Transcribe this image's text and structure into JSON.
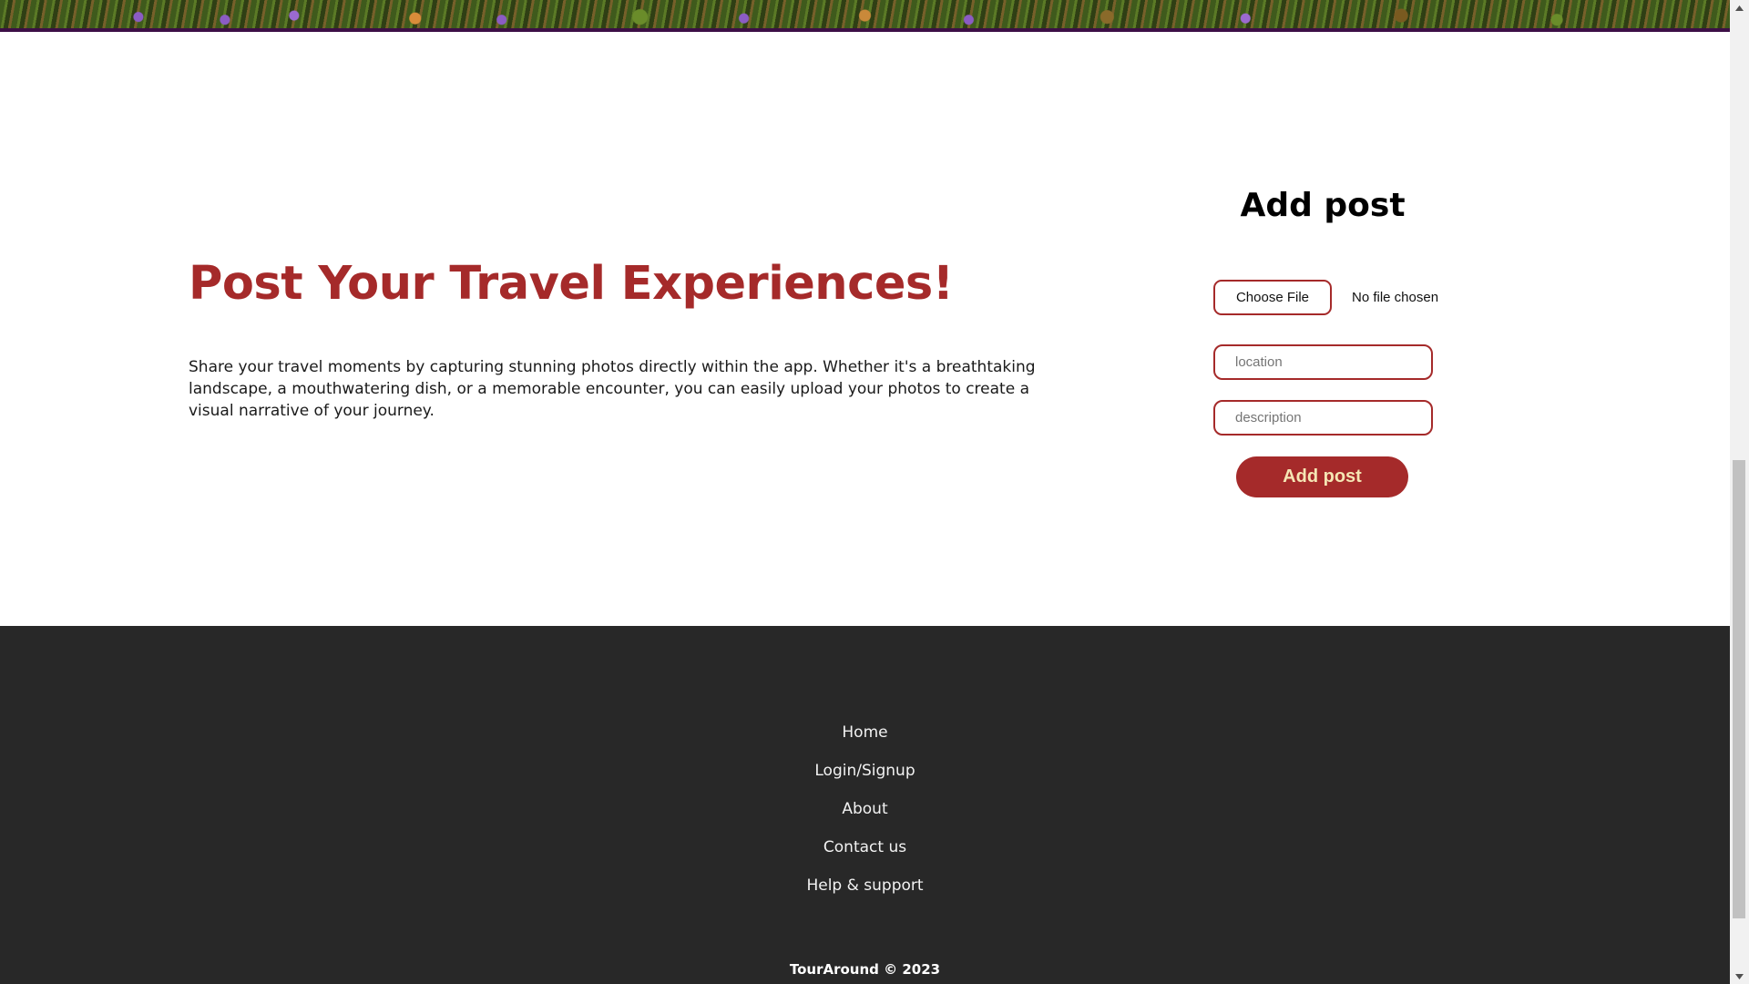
{
  "main": {
    "title": "Post Your Travel Experiences!",
    "description": "Share your travel moments by capturing stunning photos directly within the app. Whether it's a breathtaking landscape, a mouthwatering dish, or a memorable encounter, you can easily upload your photos to create a visual narrative of your journey."
  },
  "form": {
    "title": "Add post",
    "file_button": "Choose File",
    "file_status": "No file chosen",
    "location_placeholder": "location",
    "description_placeholder": "description",
    "submit_label": "Add post"
  },
  "footer": {
    "links": [
      "Home",
      "Login/Signup",
      "About",
      "Contact us",
      "Help & support"
    ],
    "copyright": "TourAround © 2023"
  },
  "colors": {
    "accent": "#a52a2a",
    "footer_bg": "#282828",
    "button_text": "#f5e6b4",
    "hero_border": "#3d0f46"
  },
  "icons": {
    "scroll_up": "triangle-up-icon",
    "scroll_down": "triangle-down-icon"
  }
}
